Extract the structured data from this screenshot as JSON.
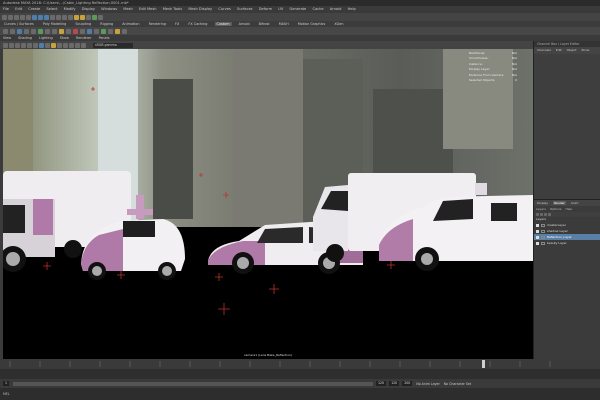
{
  "app": {
    "title": "Autodesk MAYA 2018: C:\\Users\\...\\Cabin_Lighting Reflection.0001.mb*"
  },
  "menu": [
    "File",
    "Edit",
    "Create",
    "Select",
    "Modify",
    "Display",
    "Windows",
    "Mesh",
    "Edit Mesh",
    "Mesh Tools",
    "Mesh Display",
    "Curves",
    "Surfaces",
    "Deform",
    "UV",
    "Generate",
    "Cache",
    "Arnold",
    "Help"
  ],
  "shelf_tabs": [
    {
      "label": "Curves / Surfaces",
      "active": false
    },
    {
      "label": "Poly Modeling",
      "active": false
    },
    {
      "label": "Sculpting",
      "active": false
    },
    {
      "label": "Rigging",
      "active": false
    },
    {
      "label": "Animation",
      "active": false
    },
    {
      "label": "Rendering",
      "active": false
    },
    {
      "label": "FX",
      "active": false
    },
    {
      "label": "FX Caching",
      "active": false
    },
    {
      "label": "Custom",
      "active": true
    },
    {
      "label": "Arnold",
      "active": false
    },
    {
      "label": "Bifrost",
      "active": false
    },
    {
      "label": "MASH",
      "active": false
    },
    {
      "label": "Motion Graphics",
      "active": false
    },
    {
      "label": "XGen",
      "active": false
    }
  ],
  "panel_menu": [
    "View",
    "Shading",
    "Lighting",
    "Show",
    "Renderer",
    "Panels"
  ],
  "viewport": {
    "camera_select": "sRGB gamma",
    "hud": [
      {
        "label": "Backfaces:",
        "value": "N/A"
      },
      {
        "label": "Smoothness:",
        "value": "N/A"
      },
      {
        "label": "Instance:",
        "value": "N/A"
      },
      {
        "label": "Display Layer:",
        "value": "N/A"
      },
      {
        "label": "Distance From Camera:",
        "value": "N/A"
      },
      {
        "label": "Selected Objects:",
        "value": "0"
      }
    ],
    "caption": "camera1 (Lens Bake_Reflection)"
  },
  "right_panel": {
    "header": "Channel Box / Layer Editor",
    "tabs": [
      "Channels",
      "Edit",
      "Object",
      "Show"
    ],
    "layer_tabs": [
      {
        "label": "Display",
        "active": false
      },
      {
        "label": "Render",
        "active": true
      },
      {
        "label": "Anim",
        "active": false
      }
    ],
    "layer_menu": [
      "Layers",
      "Options",
      "Help"
    ],
    "section_label": "Layers",
    "layers": [
      {
        "name": "masterLayer",
        "selected": false
      },
      {
        "name": "shadow Layer",
        "selected": false
      },
      {
        "name": "Reflection_Layer",
        "selected": true
      },
      {
        "name": "beauty Layer",
        "selected": false
      }
    ]
  },
  "range": {
    "start": "1",
    "current": "120",
    "end": "120",
    "end2": "200",
    "layer": "No Anim Layer",
    "char_set": "No Character Set"
  },
  "command": {
    "label": "MEL"
  },
  "colors": {
    "accent": "#5a7fa6",
    "viewport_bg": "#000000",
    "car_body": "#f0eef0",
    "car_tint": "#b07aa8"
  }
}
